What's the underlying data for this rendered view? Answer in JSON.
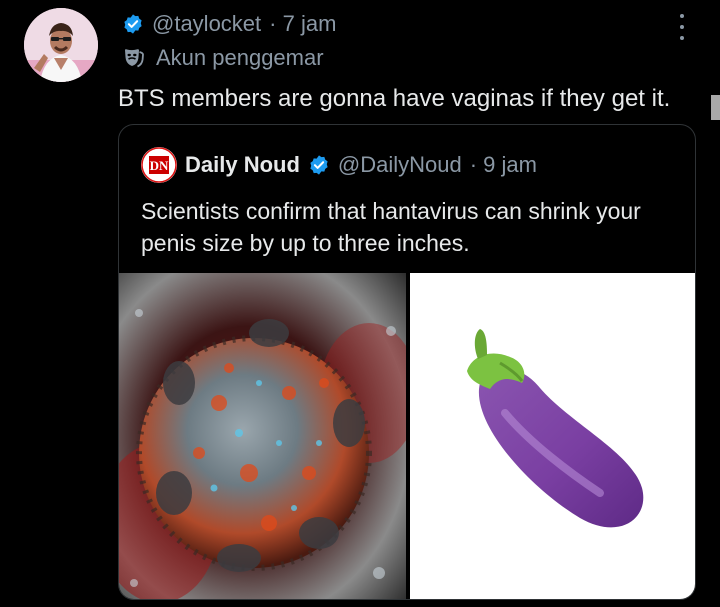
{
  "tweet": {
    "handle": "@taylocket",
    "time": "· 7 jam",
    "account_label": "Akun penggemar",
    "text": "BTS members are gonna have vaginas if they get it."
  },
  "quoted": {
    "logo_text": "DN",
    "name": "Daily Noud",
    "handle": "@DailyNoud",
    "time": "· 9 jam",
    "text": "Scientists confirm that hantavirus can shrink your penis size by up to three inches."
  },
  "colors": {
    "verified": "#1d9bf0",
    "secondary_text": "#8b98a5",
    "primary_text": "#e7e9ea",
    "border": "#2f3336"
  },
  "icons": {
    "verified": "verified-badge-icon",
    "fan_account": "theater-masks-icon",
    "more": "more-options-icon"
  }
}
